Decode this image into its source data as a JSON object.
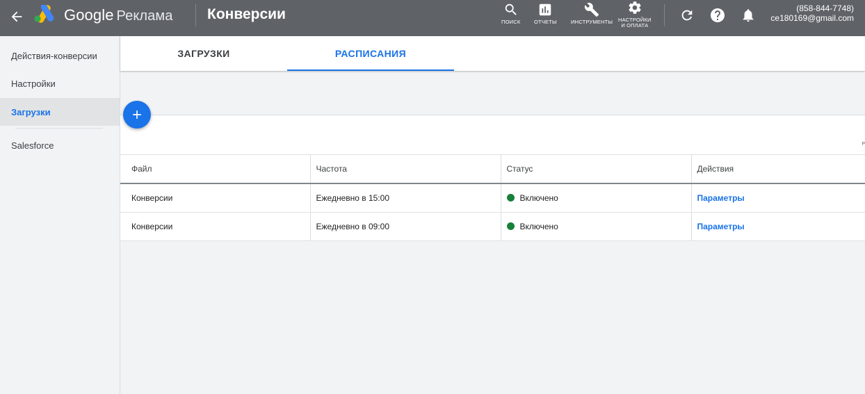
{
  "header": {
    "brand_google": "Google",
    "brand_product": "Реклама",
    "page_title": "Конверсии",
    "tools": [
      {
        "icon": "search-icon",
        "label": "ПОИСК"
      },
      {
        "icon": "reports-icon",
        "label": "ОТЧЕТЫ"
      },
      {
        "icon": "wrench-icon",
        "label": "ИНСТРУМЕНТЫ"
      },
      {
        "icon": "gear-icon",
        "label_line1": "НАСТРОЙКИ",
        "label_line2": "И ОПЛАТА"
      }
    ],
    "account_phone": "(858-844-7748)",
    "account_email": "ce180169@gmail.com"
  },
  "sidebar": {
    "items": [
      {
        "label": "Действия-конверсии",
        "active": false
      },
      {
        "label": "Настройки",
        "active": false
      },
      {
        "label": "Загрузки",
        "active": true
      },
      {
        "label": "Salesforce",
        "active": false
      }
    ]
  },
  "tabs": [
    {
      "label": "ЗАГРУЗКИ",
      "active": false
    },
    {
      "label": "РАСПИСАНИЯ",
      "active": true
    }
  ],
  "card": {
    "cut_label": "Р"
  },
  "table": {
    "columns": [
      "Файл",
      "Частота",
      "Статус",
      "Действия"
    ],
    "rows": [
      {
        "file": "Конверсии",
        "frequency": "Ежедневно в 15:00",
        "status": "Включено",
        "action": "Параметры"
      },
      {
        "file": "Конверсии",
        "frequency": "Ежедневно в 09:00",
        "status": "Включено",
        "action": "Параметры"
      }
    ]
  },
  "colors": {
    "topbar": "#5f6368",
    "accent": "#1a73e8",
    "status_enabled": "#188038"
  }
}
